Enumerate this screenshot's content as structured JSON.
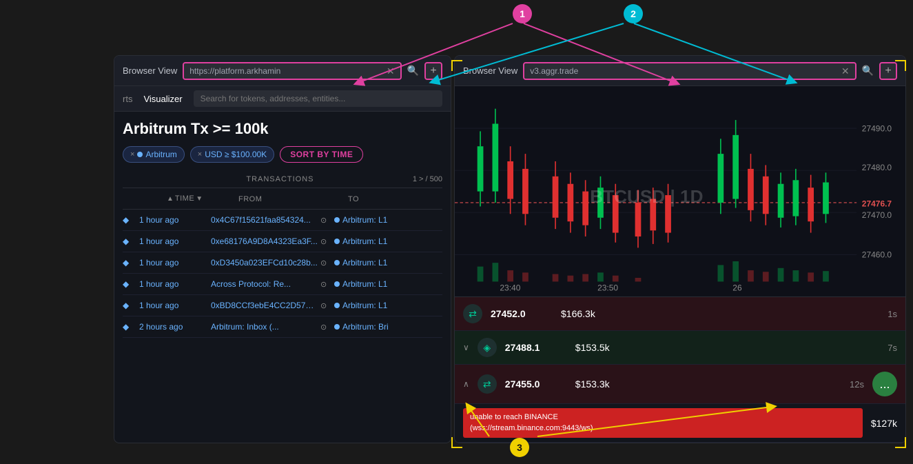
{
  "annotations": {
    "circle1": {
      "label": "1",
      "color": "magenta"
    },
    "circle2": {
      "label": "2",
      "color": "cyan"
    },
    "circle3": {
      "label": "3",
      "color": "yellow"
    }
  },
  "left_panel": {
    "browser_view_label": "Browser View",
    "url": "https://platform.arkhamin",
    "nav_items": [
      "rts",
      "Visualizer"
    ],
    "search_placeholder": "Search for tokens, addresses, entities...",
    "page_title": "Arbitrum Tx >= 100k",
    "filters": {
      "tag1": "Arbitrum",
      "tag2": "USD ≥ $100.00K"
    },
    "sort_btn": "SORT BY TIME",
    "transactions_label": "TRANSACTIONS",
    "pagination": "1 > / 500",
    "columns": {
      "time": "TIME",
      "from": "FROM",
      "to": "TO"
    },
    "rows": [
      {
        "time": "1 hour ago",
        "from": "0x4C67f15621faa854324...",
        "to": "Arbitrum: L1"
      },
      {
        "time": "1 hour ago",
        "from": "0xe68176A9D8A4323Ea3F...",
        "to": "Arbitrum: L1"
      },
      {
        "time": "1 hour ago",
        "from": "0xD3450a023EFCd10c28b...",
        "to": "Arbitrum: L1"
      },
      {
        "time": "1 hour ago",
        "from": "Across Protocol: Re...",
        "to": "Arbitrum: L1"
      },
      {
        "time": "1 hour ago",
        "from": "0xBD8CCf3ebE4CC2D5796...",
        "to": "Arbitrum: L1"
      },
      {
        "time": "2 hours ago",
        "from": "Arbitrum: Inbox (...",
        "to": "Arbitrum: Bri"
      }
    ]
  },
  "right_panel": {
    "browser_view_label": "Browser View",
    "url": "v3.aggr.trade",
    "chart": {
      "symbol": "BTCUSD | 1D",
      "prices": [
        27490.0,
        27480.0,
        27476.7,
        27470.0,
        27460.0
      ],
      "current_price": "27476.7",
      "times": [
        "23:40",
        "23:50",
        "26"
      ]
    },
    "trades": [
      {
        "direction": "sell",
        "price": "27452.0",
        "value": "$166.3k",
        "time": "1s"
      },
      {
        "direction": "buy",
        "price": "27488.1",
        "value": "$153.5k",
        "time": "7s"
      },
      {
        "direction": "sell",
        "price": "27455.0",
        "value": "$153.3k",
        "time": "12s"
      },
      {
        "direction": "neutral",
        "price": "",
        "value": "$127k",
        "time": ""
      }
    ],
    "error": {
      "message": "unable to reach BINANCE",
      "detail": "(wss://stream.binance.com:9443/ws)"
    },
    "more_btn": "..."
  }
}
